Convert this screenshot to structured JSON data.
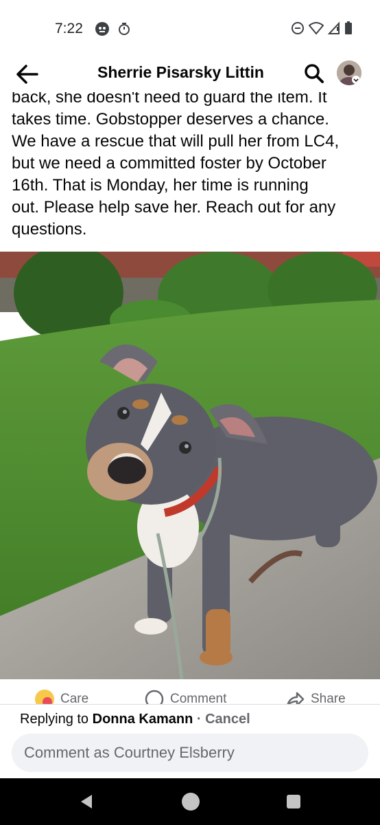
{
  "status_bar": {
    "time": "7:22",
    "left_icons": [
      "notification-app-icon",
      "alarm-icon"
    ],
    "right_icons": [
      "do-not-disturb-icon",
      "wifi-icon",
      "signal-icon",
      "battery-icon"
    ]
  },
  "header": {
    "title": "Sherrie Pisarsky Littin",
    "back_icon": "back-arrow-icon",
    "search_icon": "search-icon",
    "avatar_icon": "profile-avatar"
  },
  "post": {
    "lines": [
      "back, she doesn't need to guard the item. It",
      "takes time. Gobstopper deserves a chance.",
      "We have a rescue that will pull her from LC4,",
      "but we need a committed foster by October",
      "16th. That is Monday, her time is running",
      "out. Please help save her. Reach out for any",
      "questions."
    ],
    "photo_subject": "dog-photo"
  },
  "actions": {
    "care_label": "Care",
    "comment_label": "Comment",
    "share_label": "Share",
    "care_icon": "care-emoji-icon",
    "comment_icon": "comment-bubble-icon",
    "share_icon": "share-arrow-icon"
  },
  "reply": {
    "prefix": "Replying to ",
    "name": "Donna Kamann",
    "separator": " · ",
    "cancel_label": "Cancel",
    "placeholder": "Comment as Courtney Elsberry"
  },
  "nav": {
    "icons": [
      "nav-back-icon",
      "nav-home-icon",
      "nav-recents-icon"
    ]
  },
  "colors": {
    "text_primary": "#050505",
    "text_secondary": "#65676b",
    "input_bg": "#f0f2f5",
    "nav_bg": "#000000"
  }
}
